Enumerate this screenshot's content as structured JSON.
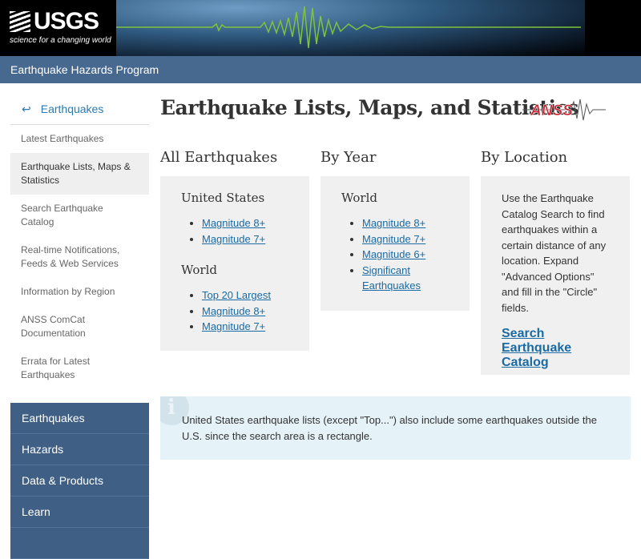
{
  "header": {
    "logo_text": "USGS",
    "logo_tagline": "science for a changing world",
    "program": "Earthquake Hazards Program"
  },
  "sidebar": {
    "back_icon": "↩",
    "back_label": "Earthquakes",
    "items": [
      {
        "label": "Latest Earthquakes"
      },
      {
        "label": "Earthquake Lists, Maps & Statistics"
      },
      {
        "label": "Search Earthquake Catalog"
      },
      {
        "label": "Real-time Notifications, Feeds & Web Services"
      },
      {
        "label": "Information by Region"
      },
      {
        "label": "ANSS ComCat Documentation"
      },
      {
        "label": "Errata for Latest Earthquakes"
      }
    ],
    "sections": [
      {
        "label": "Earthquakes"
      },
      {
        "label": "Hazards"
      },
      {
        "label": "Data & Products"
      },
      {
        "label": "Learn"
      }
    ]
  },
  "main": {
    "title": "Earthquake Lists, Maps, and Statistics",
    "anss_logo": "ANSS",
    "all": {
      "heading": "All Earthquakes",
      "us_heading": "United States",
      "us": [
        "Magnitude 8+",
        "Magnitude 7+"
      ],
      "world_heading": "World",
      "world": [
        "Top 20 Largest",
        "Magnitude 8+",
        "Magnitude 7+"
      ]
    },
    "year": {
      "heading": "By Year",
      "world_heading": "World",
      "world": [
        "Magnitude 8+",
        "Magnitude 7+",
        "Magnitude 6+",
        "Significant Earthquakes"
      ]
    },
    "location": {
      "heading": "By Location",
      "text": "Use the Earthquake Catalog Search to find earthquakes within a certain distance of any location. Expand \"Advanced Options\" and fill in the \"Circle\" fields.",
      "link": "Search Earthquake Catalog"
    },
    "info": {
      "icon": "i",
      "text": "United States earthquake lists (except \"Top...\") also include some earthquakes outside the U.S. since the search area is a rectangle."
    }
  }
}
